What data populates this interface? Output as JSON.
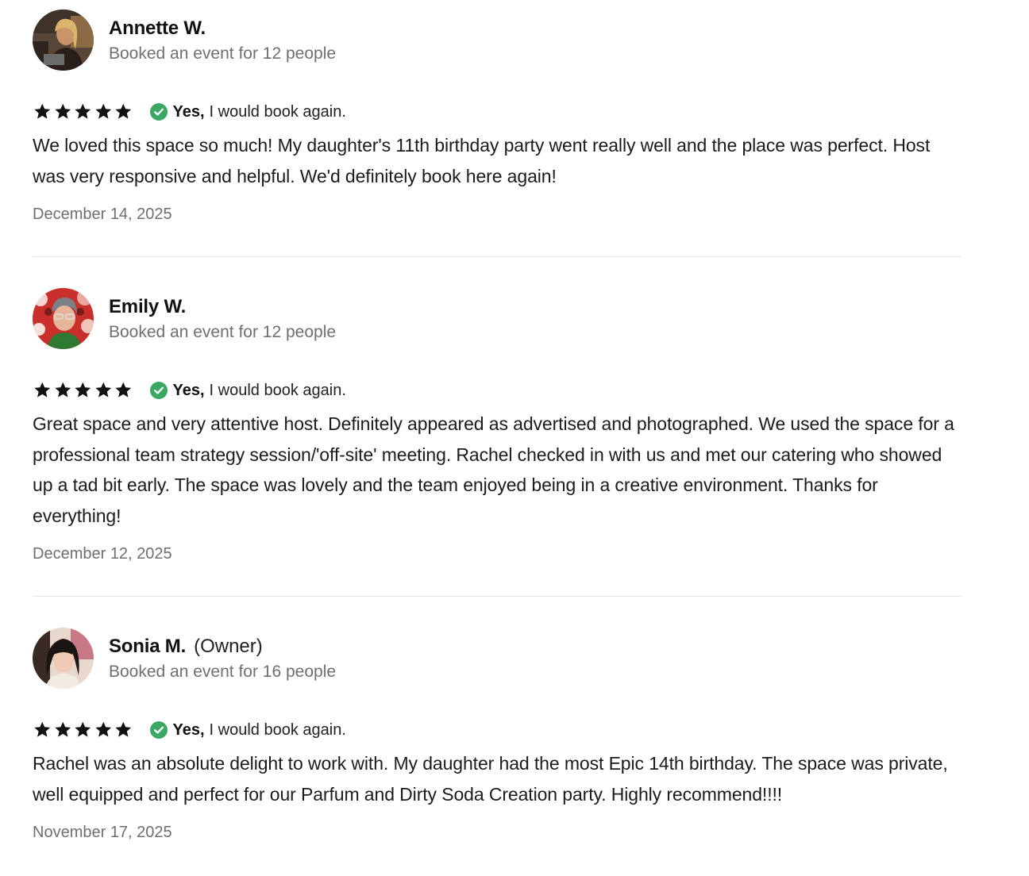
{
  "reviews": [
    {
      "name": "Annette W.",
      "owner_tag": "",
      "booking_info": "Booked an event for 12 people",
      "rating": 5,
      "yes_label": "Yes,",
      "book_again_text": "I would book again.",
      "text": "We loved this space so much! My daughter's 11th birthday party went really well and the place was perfect. Host was very responsive and helpful. We'd definitely book here again!",
      "date": "December 14, 2025"
    },
    {
      "name": "Emily W.",
      "owner_tag": "",
      "booking_info": "Booked an event for 12 people",
      "rating": 5,
      "yes_label": "Yes,",
      "book_again_text": "I would book again.",
      "text": "Great space and very attentive host. Definitely appeared as advertised and photographed. We used the space for a professional team strategy session/'off-site' meeting. Rachel checked in with us and met our catering who showed up a tad bit early. The space was lovely and the team enjoyed being in a creative environment. Thanks for everything!",
      "date": "December 12, 2025"
    },
    {
      "name": "Sonia M.",
      "owner_tag": "(Owner)",
      "booking_info": "Booked an event for 16 people",
      "rating": 5,
      "yes_label": "Yes,",
      "book_again_text": "I would book again.",
      "text": "Rachel was an absolute delight to work with. My daughter had the most Epic 14th birthday. The space was private, well equipped and perfect for our Parfum and Dirty Soda Creation party. Highly recommend!!!!",
      "date": "November 17, 2025"
    }
  ],
  "icons": {
    "star": "star-icon",
    "verified": "check-circle-icon"
  },
  "colors": {
    "star": "#111111",
    "verified_green": "#3aa864",
    "muted_text": "#6f6f72",
    "divider": "#e4e4e6"
  }
}
